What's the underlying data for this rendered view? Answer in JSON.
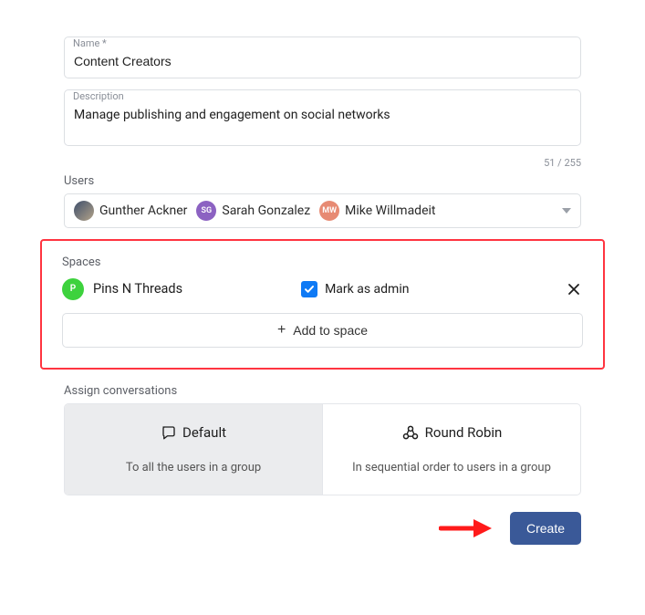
{
  "name_field": {
    "label": "Name *",
    "value": "Content Creators"
  },
  "description_field": {
    "label": "Description",
    "value": "Manage publishing and engagement on social networks",
    "counter": "51 / 255"
  },
  "users_section": {
    "label": "Users",
    "users": [
      {
        "initials": "",
        "name": "Gunther Ackner",
        "avatar_class": "avatar-photo"
      },
      {
        "initials": "SG",
        "name": "Sarah Gonzalez",
        "avatar_class": "avatar-sg"
      },
      {
        "initials": "MW",
        "name": "Mike Willmadeit",
        "avatar_class": "avatar-mw"
      }
    ]
  },
  "spaces_section": {
    "label": "Spaces",
    "space_initial": "P",
    "space_name": "Pins N Threads",
    "mark_admin_label": "Mark as admin",
    "mark_admin_checked": true,
    "add_button": "Add to space"
  },
  "assign_section": {
    "label": "Assign conversations",
    "options": [
      {
        "title": "Default",
        "subtitle": "To all the users in a group",
        "selected": true
      },
      {
        "title": "Round Robin",
        "subtitle": "In sequential order to users in a group",
        "selected": false
      }
    ]
  },
  "footer": {
    "create_label": "Create"
  }
}
